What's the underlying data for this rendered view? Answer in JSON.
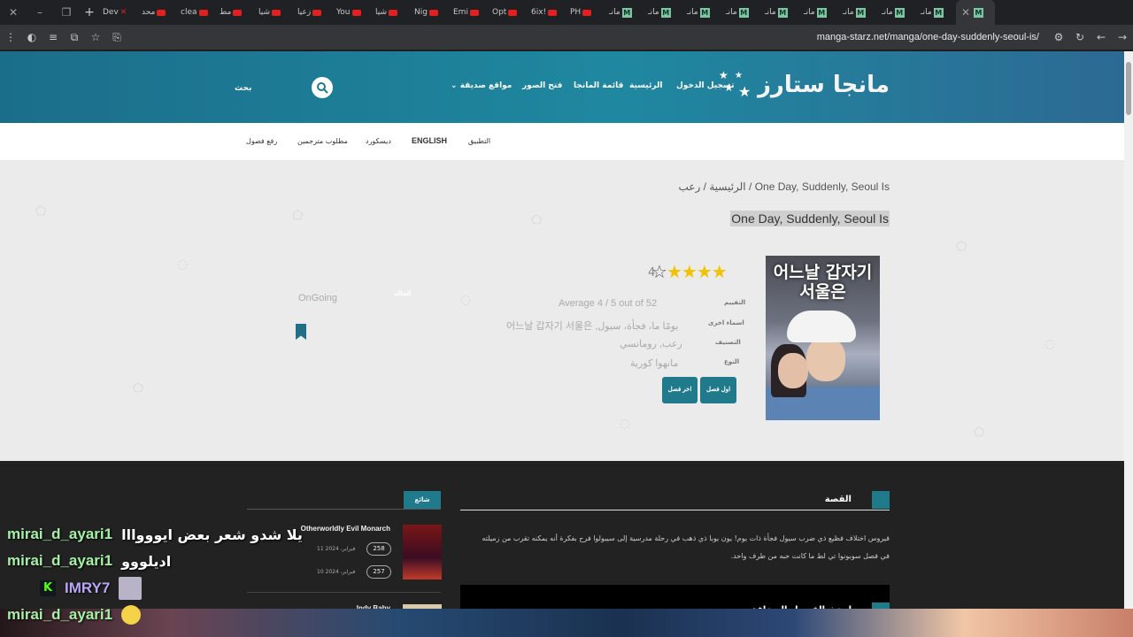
{
  "browser": {
    "tabs": [
      {
        "label": "Dev",
        "favicon": "x-icon"
      },
      {
        "label": "محد",
        "favicon": "youtube-icon"
      },
      {
        "label": "clea",
        "favicon": "youtube-icon"
      },
      {
        "label": "مط",
        "favicon": "youtube-icon"
      },
      {
        "label": "شيا",
        "favicon": "youtube-icon"
      },
      {
        "label": "زعيا",
        "favicon": "youtube-icon"
      },
      {
        "label": "You",
        "favicon": "youtube-icon"
      },
      {
        "label": "شيا",
        "favicon": "youtube-icon"
      },
      {
        "label": "Nig",
        "favicon": "youtube-icon"
      },
      {
        "label": "Emi",
        "favicon": "youtube-icon"
      },
      {
        "label": "Opt",
        "favicon": "youtube-icon"
      },
      {
        "label": "6ix!",
        "favicon": "youtube-icon"
      },
      {
        "label": "PH",
        "favicon": "youtube-icon"
      },
      {
        "label": "مانـ",
        "favicon": "manga-icon"
      },
      {
        "label": "مانـ",
        "favicon": "manga-icon"
      },
      {
        "label": "مانـ",
        "favicon": "manga-icon"
      },
      {
        "label": "مانـ",
        "favicon": "manga-icon"
      },
      {
        "label": "مانـ",
        "favicon": "manga-icon"
      },
      {
        "label": "مانـ",
        "favicon": "manga-icon"
      },
      {
        "label": "مانـ",
        "favicon": "manga-icon"
      },
      {
        "label": "مانـ",
        "favicon": "manga-icon"
      },
      {
        "label": "مانـ",
        "favicon": "manga-icon"
      }
    ],
    "url": "manga-starz.net/manga/one-day-suddenly-seoul-is/"
  },
  "header": {
    "logo_text": "مانجا ستارز",
    "nav": {
      "login": "تسجيل الدخول",
      "home": "الرئيسية",
      "manga_list": "قائمة المانجا",
      "open_images": "فتح الصور",
      "friend_sites": "مواقع صديقة"
    },
    "search_label": "بحث"
  },
  "subnav": {
    "app": "التطبيق",
    "english": "ENGLISH",
    "discord": "ديسكورد",
    "translators": "مطلوب مترجمين",
    "upload": "رفع فصول"
  },
  "manga": {
    "breadcrumb_home": "الرئيسية",
    "breadcrumb_sep": "/",
    "breadcrumb_genre": "رعب",
    "breadcrumb_title": "One Day, Suddenly, Seoul Is",
    "title": "One Day, Suddenly, Seoul Is",
    "cover_title": "어느날 갑자기 서울은",
    "rating_value": "4",
    "stars_on": 4,
    "stars_total": 5,
    "info": {
      "rating_label": "التقييم",
      "rating_value": "Average 4 / 5 out of 52",
      "alt_label": "اسماء اخرى",
      "alt_value": "어느날 갑자기 서울은 ,يومًا ما، فجأة، سيول",
      "genre_label": "التصنيف",
      "genre_value": "رعب, رومانسي",
      "type_label": "النوع",
      "type_value": "مانهوا كورية",
      "status_label": "الحالة",
      "status_value": "OnGoing"
    },
    "btn_first": "اول فصل",
    "btn_last": "اخر فصل"
  },
  "story": {
    "heading": "القصة",
    "text": "فيروس اختلاف فظيع ذي ضرب سيول فجأة ذات يوم! يون يوبا ذي ذهب في رحلة مدرسية إلى سيبولوا فرح بفكرة أنه يمكنه تقرب من زميلته في فصل سوبونوا تي لط ما كانت حبه من طرف واحد."
  },
  "latest": {
    "heading": "احدث الفصول المضافة"
  },
  "trending": {
    "tag": "شائع",
    "items": [
      {
        "title": "Otherworldly Evil Monarch",
        "chapters": [
          {
            "num": "258",
            "date": "11 فبراير، 2024"
          },
          {
            "num": "257",
            "date": "10 فبراير، 2024"
          }
        ]
      },
      {
        "title": "Indy Baby",
        "chapters": []
      }
    ]
  },
  "chat": [
    {
      "user": "mirai_d_ayari1",
      "message": "يلا شدو شعر بعض ايوووااا",
      "badge": "",
      "emoji": false
    },
    {
      "user": "mirai_d_ayari1",
      "message": "اديلووو",
      "badge": "",
      "emoji": false
    },
    {
      "user": "IMRY7",
      "message": "",
      "badge": "K",
      "emoji": false
    },
    {
      "user": "mirai_d_ayari1",
      "message": "",
      "badge": "",
      "emoji": true
    }
  ],
  "colors": {
    "accent": "#1f7a8c",
    "header_start": "#1b6e8a",
    "header_end": "#2d6a93",
    "star": "#f2c200",
    "chat_green": "#a6f0a6"
  }
}
